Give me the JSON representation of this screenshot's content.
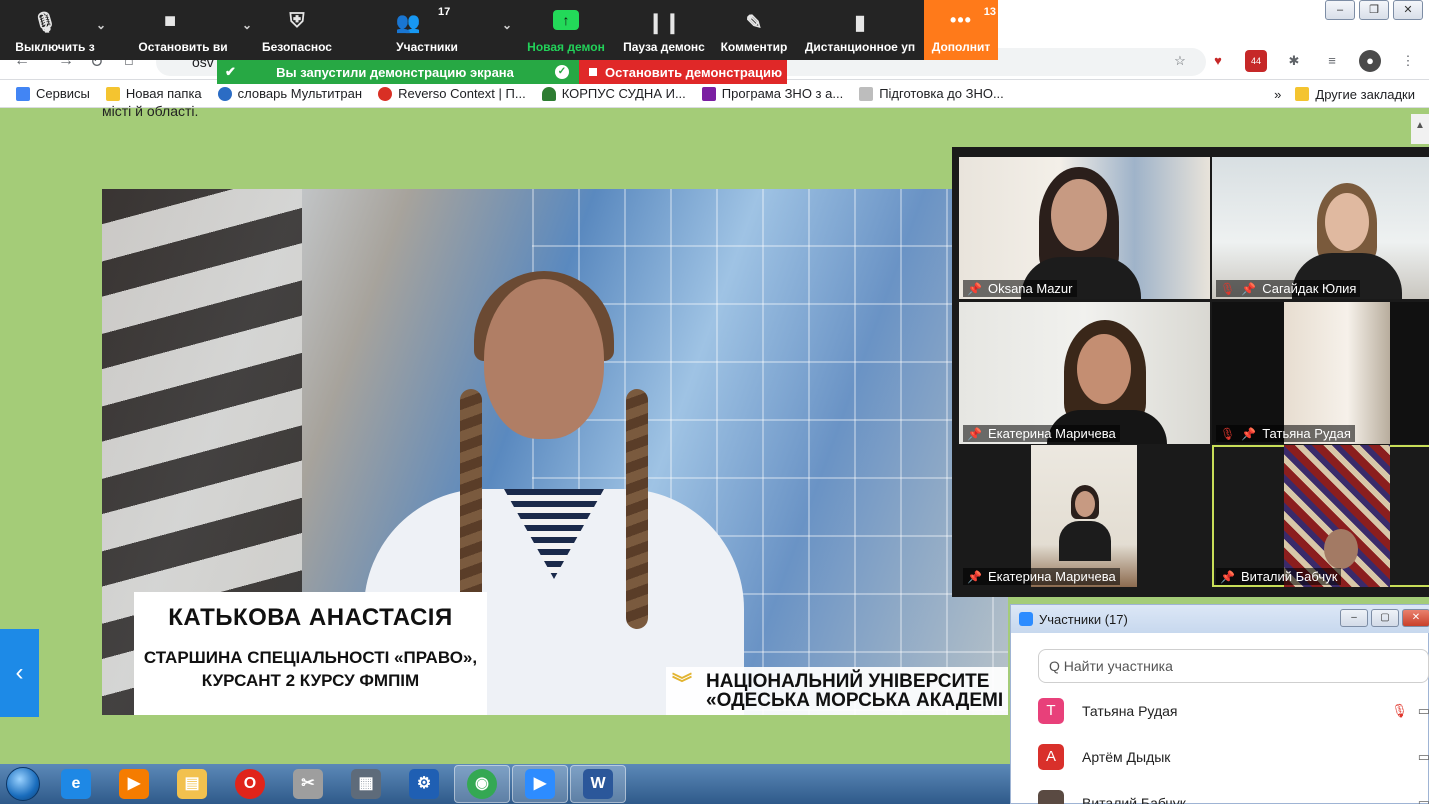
{
  "zoom_toolbar": {
    "buttons": [
      {
        "label": "Выключить з",
        "icon": "microphone-icon",
        "glyph": "🎙"
      },
      {
        "label": "Остановить ви",
        "icon": "video-camera-icon",
        "glyph": "■"
      },
      {
        "label": "Безопаснос",
        "icon": "shield-icon",
        "glyph": "⛨"
      },
      {
        "label": "Участники",
        "icon": "participants-icon",
        "glyph": "👥",
        "count": "17"
      },
      {
        "label": "Новая демон",
        "icon": "share-screen-icon",
        "glyph": "↑"
      },
      {
        "label": "Пауза демонс",
        "icon": "pause-icon",
        "glyph": "❙❙"
      },
      {
        "label": "Комментир",
        "icon": "pen-icon",
        "glyph": "✎"
      },
      {
        "label": "Дистанционное уп",
        "icon": "mouse-icon",
        "glyph": "▮"
      },
      {
        "label": "Дополнит",
        "icon": "more-icon",
        "glyph": "•••",
        "count": "13"
      }
    ],
    "caret": "⌄"
  },
  "share_banner": {
    "text": "Вы запустили демонстрацию экрана",
    "stop": "Остановить демонстрацию"
  },
  "browser": {
    "url": "osv",
    "window_controls": [
      "–",
      "❐",
      "✕"
    ],
    "extension_badge": "44",
    "bookmarks": [
      {
        "label": "Сервисы",
        "color": "#4285f4"
      },
      {
        "label": "Новая папка",
        "color": "#f4c430"
      },
      {
        "label": "словарь Мультитран",
        "color": "#2b6cc4"
      },
      {
        "label": "Reverso Context | П...",
        "color": "#d93025"
      },
      {
        "label": "КОРПУС СУДНА И...",
        "color": "#2e7d32"
      },
      {
        "label": "Програма ЗНО з а...",
        "color": "#7b1fa2"
      },
      {
        "label": "Підготовка до ЗНО...",
        "color": "#bdbdbd"
      }
    ],
    "bookmarks_more": "»",
    "other_bookmarks": "Другие закладки"
  },
  "page": {
    "top_text": "місті й області.",
    "left_arrow": "‹",
    "video": {
      "caption_name": "КАТЬКОВА АНАСТАСІЯ",
      "caption_role_line1": "СТАРШИНА СПЕЦІАЛЬНОСТІ «ПРАВО»,",
      "caption_role_line2": "КУРСАНТ 2 КУРСУ ФМПІМ",
      "university_line1": "НАЦІОНАЛЬНИЙ УНІВЕРСИТЕ",
      "university_line2": "«ОДЕСЬКА МОРСЬКА АКАДЕМІ"
    }
  },
  "gallery": {
    "tiles": [
      {
        "name": "Oksana Mazur",
        "muted": false,
        "active": false
      },
      {
        "name": "Сагайдак Юлия",
        "muted": true,
        "active": false
      },
      {
        "name": "Екатерина Маричева",
        "muted": false,
        "active": false
      },
      {
        "name": "Татьяна Рудая",
        "muted": true,
        "active": false
      },
      {
        "name": "Екатерина Маричева",
        "muted": false,
        "active": false
      },
      {
        "name": "Виталий Бабчук",
        "muted": false,
        "active": true
      }
    ]
  },
  "participants_panel": {
    "title": "Участники (17)",
    "search_placeholder": "Q Найти участника",
    "items": [
      {
        "initial": "Т",
        "name": "Татьяна Рудая",
        "color": "#e8407a",
        "muted": true
      },
      {
        "initial": "А",
        "name": "Артём Дыдык",
        "color": "#d9302b",
        "muted": false
      },
      {
        "initial": "",
        "name": "Виталий Бабчук",
        "color": "#5a4a42",
        "muted": false
      }
    ]
  },
  "taskbar": {
    "items": [
      {
        "icon": "internet-explorer-icon",
        "glyph": "e",
        "color": "#1e88e5"
      },
      {
        "icon": "media-player-icon",
        "glyph": "▶",
        "color": "#f57c00"
      },
      {
        "icon": "file-explorer-icon",
        "glyph": "▤",
        "color": "#f2c14e"
      },
      {
        "icon": "opera-icon",
        "glyph": "O",
        "color": "#e0241a"
      },
      {
        "icon": "scissors-icon",
        "glyph": "✂",
        "color": "#9e9e9e"
      },
      {
        "icon": "calendar-icon",
        "glyph": "▦",
        "color": "#5e6b7a"
      },
      {
        "icon": "control-panel-icon",
        "glyph": "⚙",
        "color": "#1f5fb3"
      },
      {
        "icon": "chrome-icon",
        "glyph": "◉",
        "color": "#34a853",
        "active": true
      },
      {
        "icon": "zoom-icon",
        "glyph": "▶",
        "color": "#2d8cff",
        "active": true
      },
      {
        "icon": "word-icon",
        "glyph": "W",
        "color": "#2b579a",
        "active": true
      }
    ]
  }
}
